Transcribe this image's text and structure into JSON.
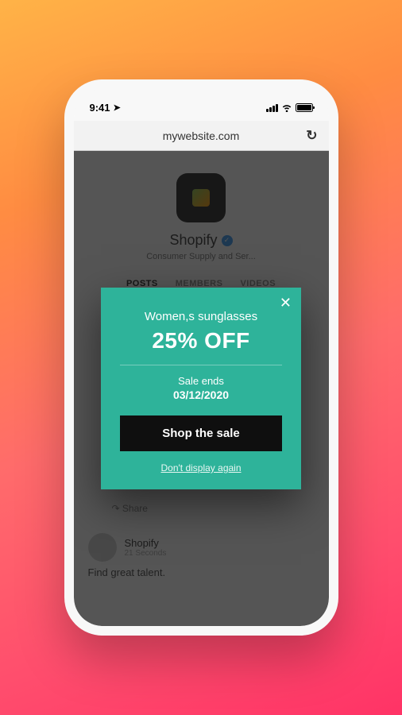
{
  "status_bar": {
    "time": "9:41"
  },
  "browser": {
    "url": "mywebsite.com"
  },
  "background": {
    "profile_name": "Shopify",
    "profile_sub": "Consumer Supply and Ser...",
    "tabs": {
      "posts": "POSTS",
      "members": "MEMBERS",
      "videos": "VIDEOS"
    },
    "share_label": "Share",
    "post": {
      "name": "Shopify",
      "time": "21 Seconds",
      "text": "Find great talent."
    }
  },
  "popup": {
    "title": "Women,s sunglasses",
    "discount": "25% OFF",
    "sale_ends_label": "Sale ends",
    "sale_ends_date": "03/12/2020",
    "cta_label": "Shop the sale",
    "dismiss_label": "Don't display again"
  }
}
